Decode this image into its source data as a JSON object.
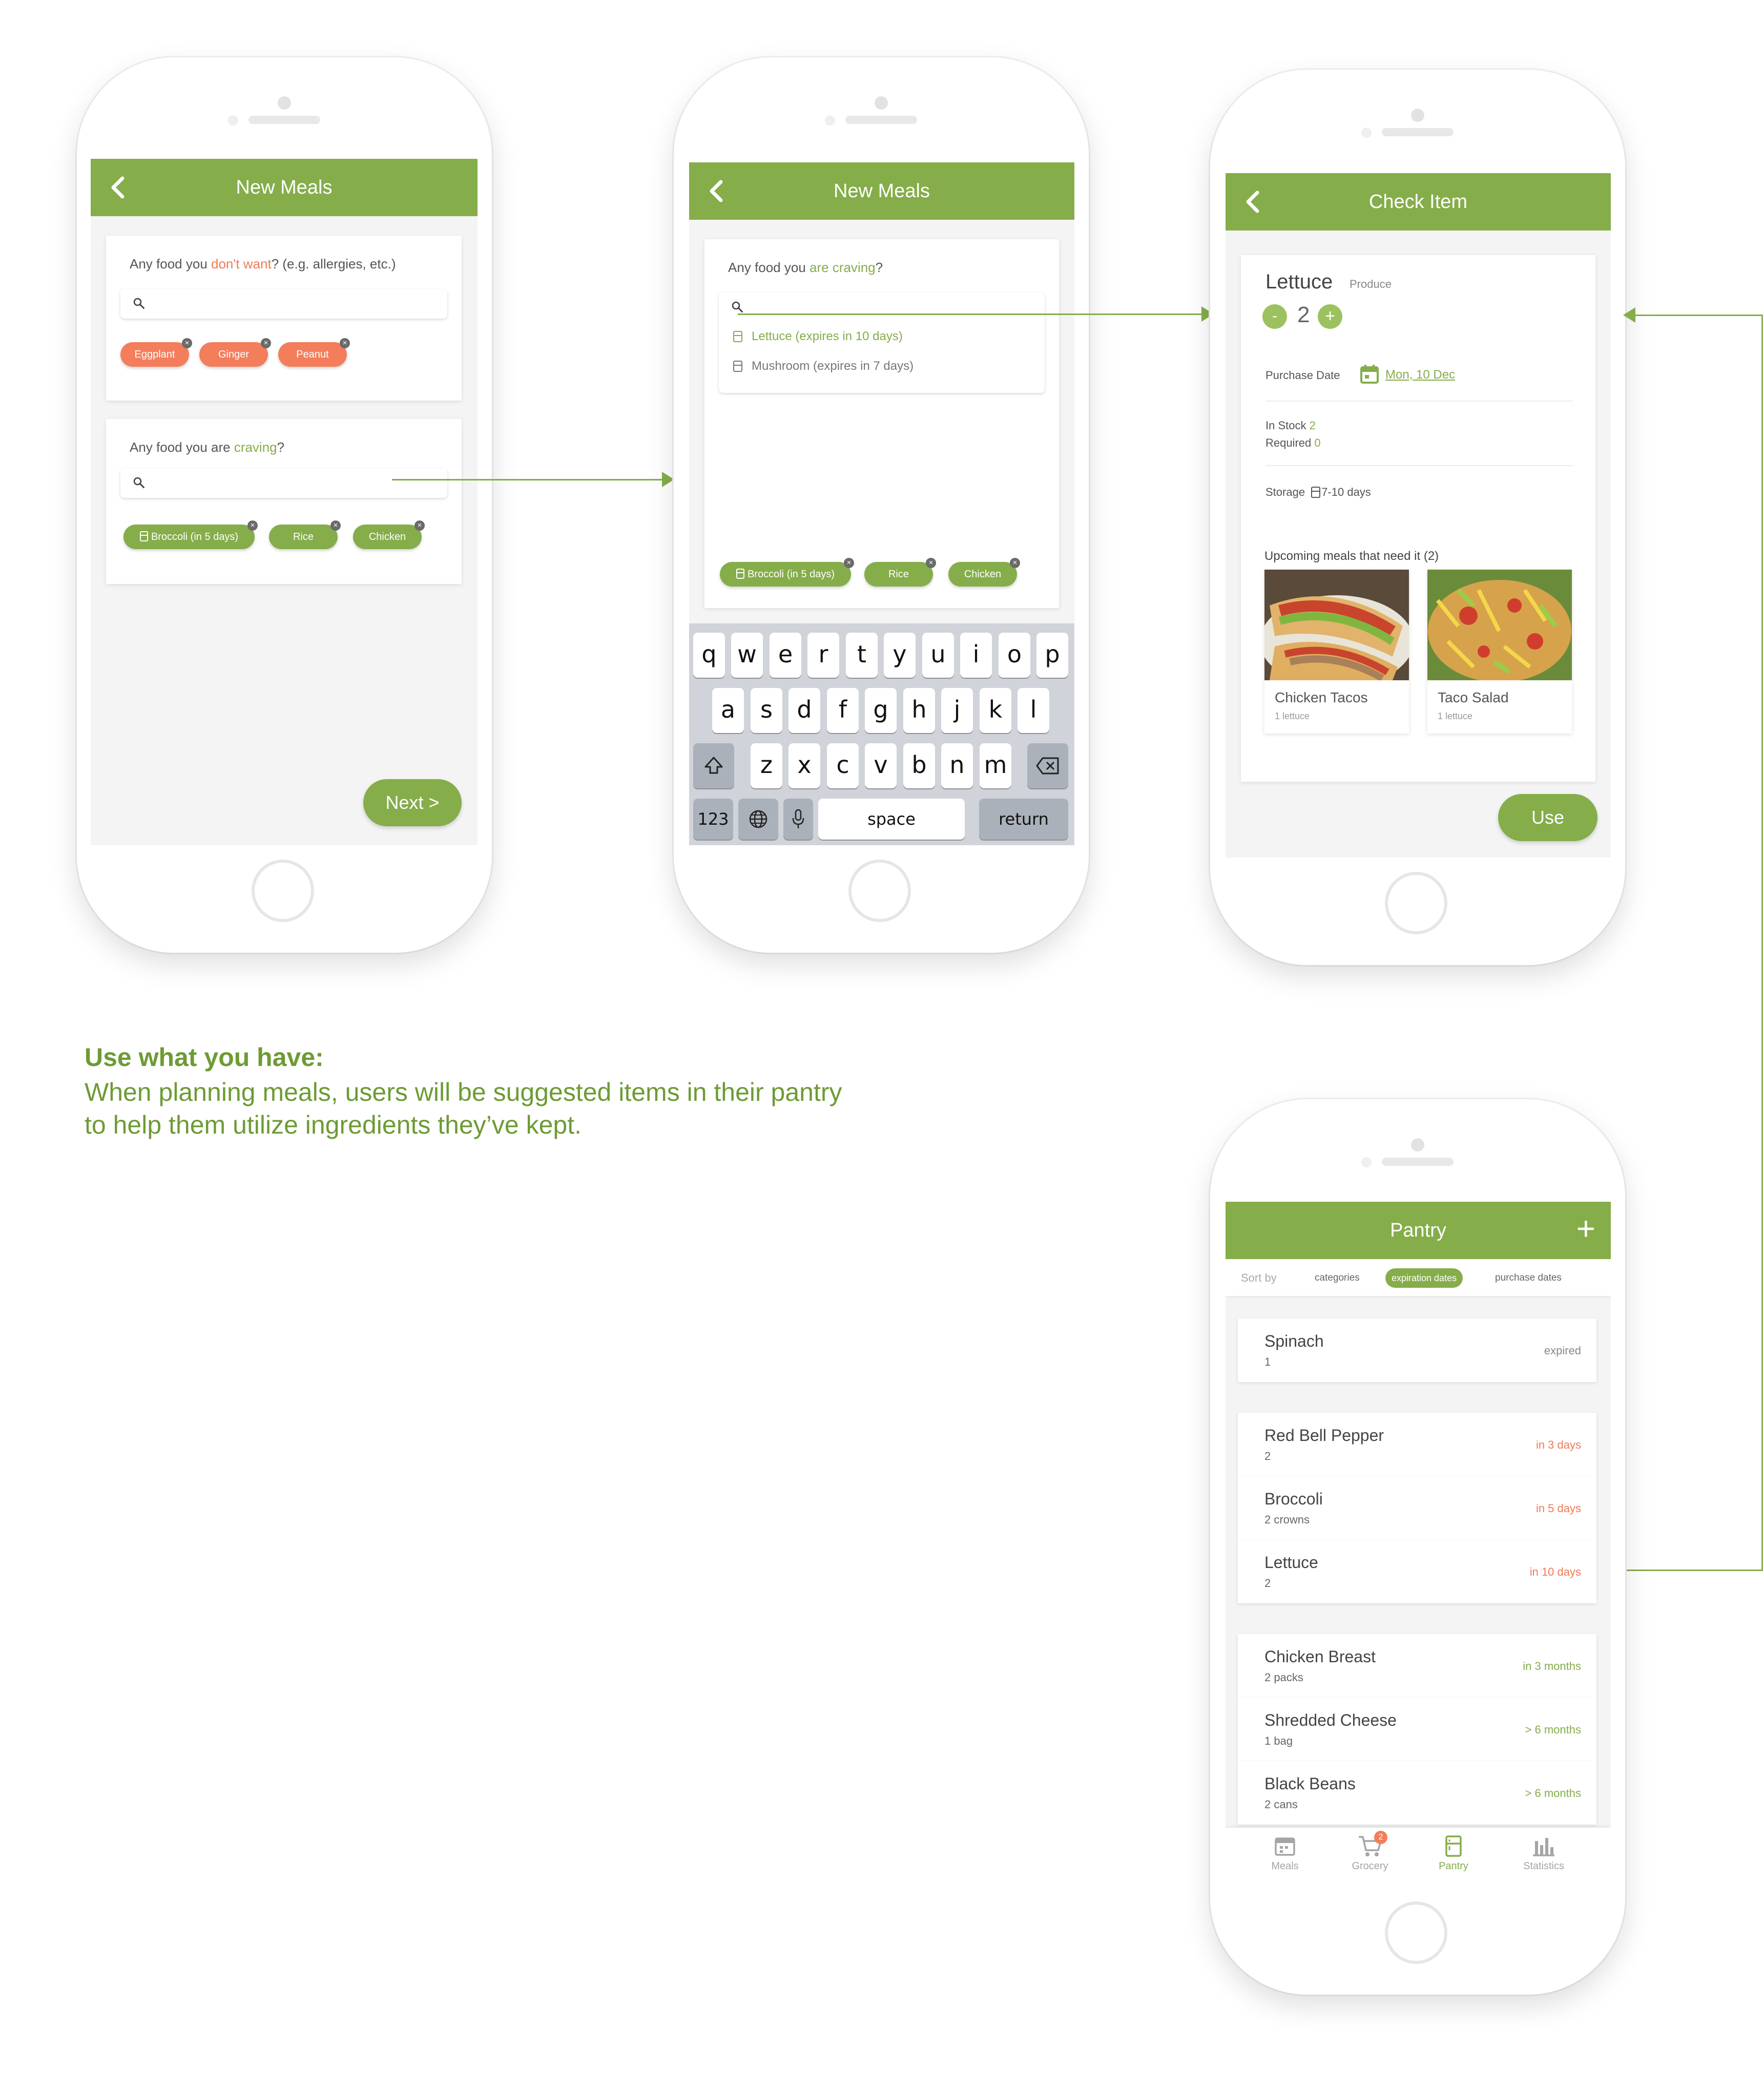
{
  "colors": {
    "accent": "#85ad4a",
    "warn": "#f47d5b",
    "text": "#555555"
  },
  "screen1": {
    "title": "New Meals",
    "q1_pre": "Any food you ",
    "q1_red": "don't want",
    "q1_post": "? (e.g. allergies, etc.)",
    "q1_chips": [
      "Eggplant",
      "Ginger",
      "Peanut"
    ],
    "q2_pre": "Any food you are ",
    "q2_grn": "craving",
    "q2_post": "?",
    "q2_chips": [
      "Broccoli (in 5 days)",
      "Rice",
      "Chicken"
    ],
    "next": "Next >"
  },
  "screen2": {
    "title": "New Meals",
    "q_pre": "Any food you ",
    "q_grn": "are craving",
    "q_post": "?",
    "suggestions": [
      "Lettuce (expires in 10 days)",
      "Mushroom (expires in 7 days)"
    ],
    "chips": [
      "Broccoli (in 5 days)",
      "Rice",
      "Chicken"
    ],
    "keyboard": {
      "row1": [
        "q",
        "w",
        "e",
        "r",
        "t",
        "y",
        "u",
        "i",
        "o",
        "p"
      ],
      "row2": [
        "a",
        "s",
        "d",
        "f",
        "g",
        "h",
        "j",
        "k",
        "l"
      ],
      "row3": [
        "z",
        "x",
        "c",
        "v",
        "b",
        "n",
        "m"
      ],
      "num": "123",
      "space": "space",
      "return": "return"
    }
  },
  "screen3": {
    "title": "Check Item",
    "item": "Lettuce",
    "category": "Produce",
    "quantity": "2",
    "minus": "-",
    "plus": "+",
    "purchase_label": "Purchase Date",
    "purchase_value": "Mon, 10 Dec",
    "in_stock_label": "In Stock",
    "in_stock_value": "2",
    "required_label": "Required",
    "required_value": "0",
    "storage_label": "Storage",
    "storage_value": "7-10 days",
    "upcoming": "Upcoming meals that need it (2)",
    "meals": [
      {
        "name": "Chicken Tacos",
        "need": "1 lettuce"
      },
      {
        "name": "Taco Salad",
        "need": "1 lettuce"
      }
    ],
    "use": "Use"
  },
  "screen4": {
    "title": "Pantry",
    "add": "+",
    "sort_by": "Sort by",
    "sorts": [
      "categories",
      "expiration dates",
      "purchase dates"
    ],
    "items": [
      {
        "name": "Spinach",
        "qty": "1",
        "when": "expired"
      },
      {
        "name": "Red Bell Pepper",
        "qty": "2",
        "when": "in 3 days"
      },
      {
        "name": "Broccoli",
        "qty": "2 crowns",
        "when": "in 5 days"
      },
      {
        "name": "Lettuce",
        "qty": "2",
        "when": "in 10 days"
      },
      {
        "name": "Chicken Breast",
        "qty": "2 packs",
        "when": "in 3 months"
      },
      {
        "name": "Shredded Cheese",
        "qty": "1 bag",
        "when": "> 6 months"
      },
      {
        "name": "Black Beans",
        "qty": "2 cans",
        "when": "> 6 months"
      }
    ],
    "nav": [
      "Meals",
      "Grocery",
      "Pantry",
      "Statistics"
    ],
    "grocery_badge": "2"
  },
  "caption": {
    "title": "Use what you have:",
    "body": "When planning meals,  users will be suggested items in their pantry to help them utilize ingredients they’ve kept."
  }
}
